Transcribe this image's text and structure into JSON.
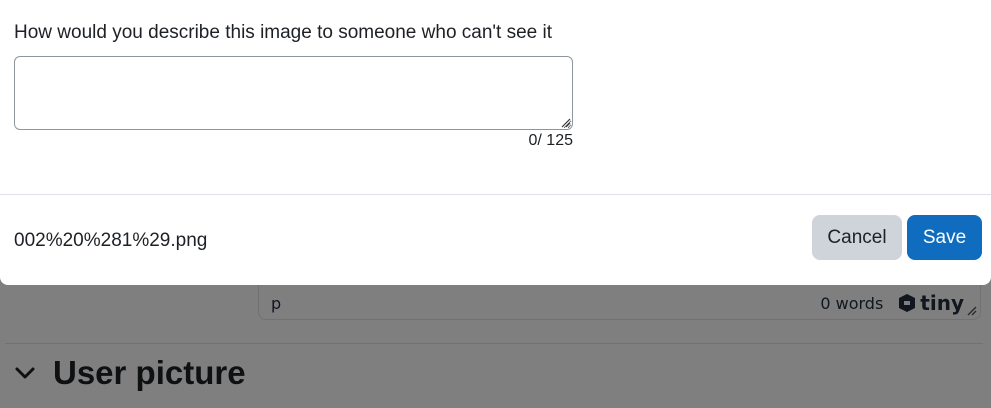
{
  "modal": {
    "prompt": "How would you describe this image to someone who can't see it",
    "alt_text": {
      "value": "",
      "placeholder": "",
      "char_count": "0",
      "char_limit": "/ 125"
    },
    "filename": "002%20%281%29.png",
    "cancel_label": "Cancel",
    "save_label": "Save"
  },
  "editor": {
    "status_path": "p",
    "word_count": "0 words",
    "brand": "tiny"
  },
  "section": {
    "title": "User picture"
  },
  "colors": {
    "primary": "#0f6cbf",
    "secondary": "#ced4da",
    "backdrop": "rgba(0,0,0,0.5)"
  }
}
